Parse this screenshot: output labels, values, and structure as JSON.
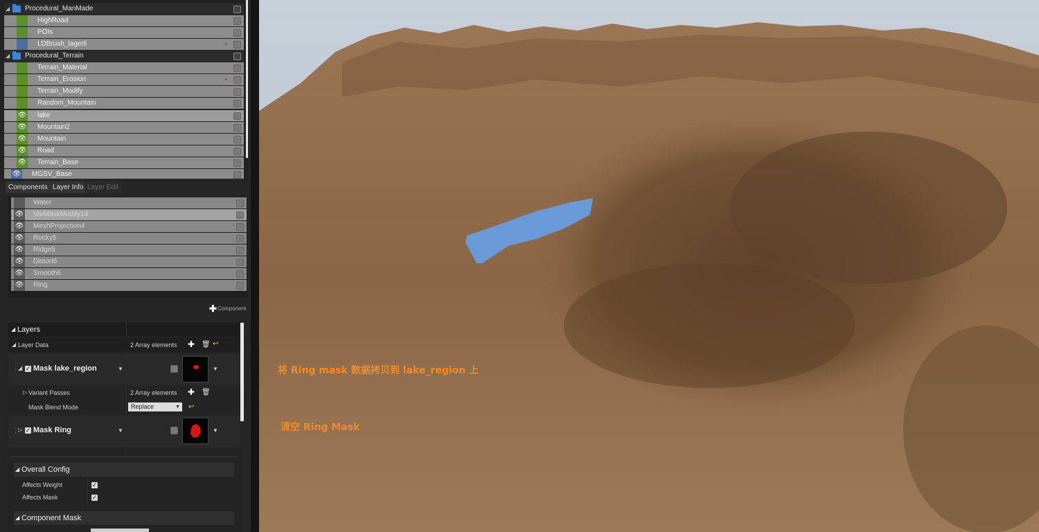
{
  "outliner": {
    "items": [
      {
        "label": "Procedural_ManMade"
      },
      {
        "label": "HighRoad"
      },
      {
        "label": "POIs"
      },
      {
        "label": "LDBrush_lagerli"
      },
      {
        "label": "Procedural_Terrain"
      },
      {
        "label": "Terrain_Material"
      },
      {
        "label": "Terrain_Erosion"
      },
      {
        "label": "Terrain_Modify"
      },
      {
        "label": "Random_Mountain"
      },
      {
        "label": "lake"
      },
      {
        "label": "Mountain2"
      },
      {
        "label": "Mountain"
      },
      {
        "label": "Road"
      },
      {
        "label": "Terrain_Base"
      },
      {
        "label": "MGSV_Base"
      }
    ]
  },
  "tabs": [
    "Components",
    "Layer Info",
    "Layer Edit"
  ],
  "components": [
    "Water",
    "VarMaskModify14",
    "MeshProjection4",
    "Rocky5",
    "Ridge5",
    "Distort6",
    "Smooth6",
    "Ring"
  ],
  "add_component": "Component",
  "details": {
    "layers_title": "Layers",
    "layer_data_label": "Layer Data",
    "layer_data_count": "2 Array elements",
    "mask1_label": "Mask lake_region",
    "variant_passes_label": "Variant Passes",
    "variant_passes_count": "2 Array elements",
    "mask_blend_mode_label": "Mask Blend Mode",
    "mask_blend_mode_value": "Replace",
    "mask2_label": "Mask Ring",
    "overall_config": "Overall Config",
    "affects_weight": "Affects Weight",
    "affects_mask": "Affects Mask",
    "component_mask": "Component Mask"
  },
  "annotations": {
    "copy_note": "将 Ring mask 数据拷贝到 lake_region 上",
    "clear_note": "清空 Ring Mask"
  },
  "colors": {
    "annotation": "#f08a2a",
    "water": "#6a9ad8",
    "terrain": "#8c6a48",
    "sky": "#b9c3d0"
  }
}
